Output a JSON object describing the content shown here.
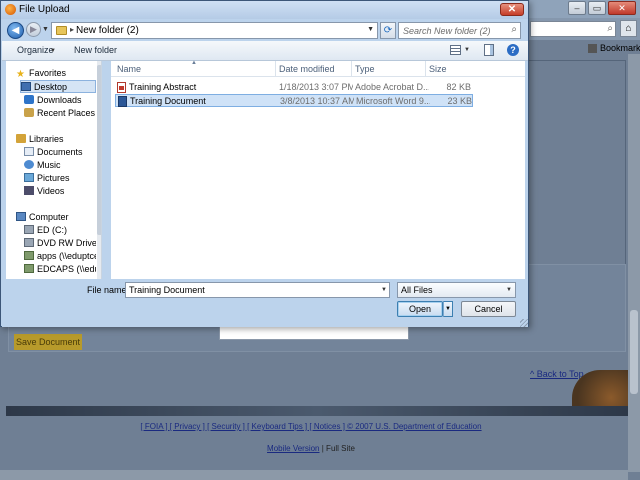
{
  "browser": {
    "bookmarks_label": "Bookmarks",
    "save_document_label": "Save Document",
    "back_to_top": "^ Back to Top",
    "footer_links": "[ FOIA ] [ Privacy ] [ Security ] [ Keyboard Tips ] [ Notices ] © 2007 U.S. Department of Education",
    "mobile_version": "Mobile Version",
    "full_site": "| Full Site"
  },
  "dialog": {
    "title": "File Upload",
    "close_glyph": "✕",
    "address": {
      "path": "New folder (2)"
    },
    "search": {
      "placeholder": "Search New folder (2)"
    },
    "toolbar": {
      "organize": "Organize",
      "new_folder": "New folder"
    },
    "nav": {
      "items": [
        {
          "label": "Favorites",
          "icon": "star-icon"
        },
        {
          "label": "Desktop",
          "icon": "desktop-icon"
        },
        {
          "label": "Downloads",
          "icon": "downloads-icon"
        },
        {
          "label": "Recent Places",
          "icon": "recent-places-icon"
        },
        {
          "label": "Libraries",
          "icon": "libraries-icon"
        },
        {
          "label": "Documents",
          "icon": "documents-icon"
        },
        {
          "label": "Music",
          "icon": "music-icon"
        },
        {
          "label": "Pictures",
          "icon": "pictures-icon"
        },
        {
          "label": "Videos",
          "icon": "videos-icon"
        },
        {
          "label": "Computer",
          "icon": "computer-icon"
        },
        {
          "label": "ED (C:)",
          "icon": "drive-icon"
        },
        {
          "label": "DVD RW Drive (D",
          "icon": "dvd-drive-icon"
        },
        {
          "label": "apps (\\\\eduptcec",
          "icon": "network-drive-icon"
        },
        {
          "label": "EDCAPS (\\\\edupt",
          "icon": "network-drive-icon"
        }
      ],
      "selected": "Desktop"
    },
    "columns": {
      "name": "Name",
      "date": "Date modified",
      "type": "Type",
      "size": "Size"
    },
    "files": [
      {
        "name": "Training Abstract",
        "date": "1/18/2013 3:07 PM",
        "type": "Adobe Acrobat D...",
        "size": "82 KB",
        "icon": "pdf-icon"
      },
      {
        "name": "Training Document",
        "date": "3/8/2013 10:37 AM",
        "type": "Microsoft Word 9...",
        "size": "23 KB",
        "icon": "word-icon"
      }
    ],
    "selected_file": "Training Document",
    "bottom": {
      "file_name_label": "File name:",
      "file_name_value": "Training Document",
      "file_type": "All Files",
      "open_label": "Open",
      "cancel_label": "Cancel"
    }
  }
}
